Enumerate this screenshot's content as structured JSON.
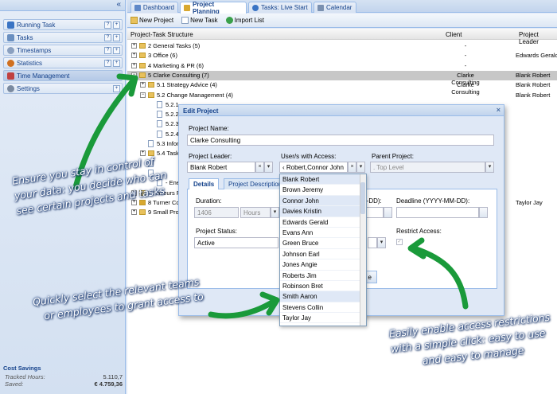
{
  "sidebar": {
    "collapse_glyph": "«",
    "items": [
      {
        "label": "Running Task",
        "icon": "play-icon",
        "color": "#3a74c4"
      },
      {
        "label": "Tasks",
        "icon": "tasks-icon",
        "color": "#6a8fc0"
      },
      {
        "label": "Timestamps",
        "icon": "clock-icon",
        "color": "#8aa0c0"
      },
      {
        "label": "Statistics",
        "icon": "chart-icon",
        "color": "#d07020"
      },
      {
        "label": "Time Management",
        "icon": "calendar-icon",
        "color": "#c04040"
      },
      {
        "label": "Settings",
        "icon": "gear-icon",
        "color": "#7a8aa0"
      }
    ],
    "btn_help": "?",
    "btn_add": "+",
    "costs": {
      "title": "Cost Savings",
      "tracked_label": "Tracked Hours:",
      "tracked_value": "5.110,7",
      "saved_label": "Saved:",
      "saved_value": "€ 4.759,36"
    }
  },
  "tabs": [
    {
      "label": "Dashboard",
      "color": "#5f88c8"
    },
    {
      "label": "Project Planning",
      "color": "#d8a830"
    },
    {
      "label": "Tasks: Live Start",
      "color": "#3a74c4"
    },
    {
      "label": "Calendar",
      "color": "#7a90b0"
    }
  ],
  "toolbar": {
    "new_project": "New Project",
    "new_task": "New Task",
    "import_list": "Import List"
  },
  "grid": {
    "col_structure": "Project-Task Structure",
    "col_client": "Client",
    "col_leader": "Project Leader",
    "rows": [
      {
        "text": "2 General Tasks (5)",
        "client": "-",
        "leader": ""
      },
      {
        "text": "3 Office (6)",
        "client": "-",
        "leader": "Edwards Gerald"
      },
      {
        "text": "4 Marketing & PR (6)",
        "client": "-",
        "leader": ""
      },
      {
        "text": "5 Clarke Consulting (7)",
        "client": "Clarke Consulting",
        "leader": "Blank Robert"
      },
      {
        "text": "5.1 Strategy Advice (4)",
        "client": "Clarke Consulting",
        "leader": "Blank Robert"
      },
      {
        "text": "5.2 Change Management (4)",
        "client": "",
        "leader": "Blank Robert"
      },
      {
        "text": "5.2.1",
        "client": "",
        "leader": ""
      },
      {
        "text": "5.2.2",
        "client": "",
        "leader": ""
      },
      {
        "text": "5.2.3",
        "client": "",
        "leader": ""
      },
      {
        "text": "5.2.4",
        "client": "",
        "leader": ""
      },
      {
        "text": "5.3 Infor",
        "client": "",
        "leader": ""
      },
      {
        "text": "5.4 Task",
        "client": "",
        "leader": ""
      },
      {
        "text": "",
        "client": "",
        "leader": ""
      },
      {
        "text": "",
        "client": "",
        "leader": ""
      },
      {
        "text": "- Ene",
        "client": "",
        "leader": ""
      },
      {
        "text": "7 Saveurs F",
        "client": "",
        "leader": ""
      },
      {
        "text": "8 Turner Co",
        "client": "",
        "leader": "Taylor Jay"
      },
      {
        "text": "9 Small Proj",
        "client": "",
        "leader": ""
      }
    ]
  },
  "dialog": {
    "title": "Edit Project",
    "close_glyph": "×",
    "name_label": "Project Name:",
    "name_value": "Clarke Consulting",
    "leader_label": "Project Leader:",
    "leader_value": "Blank Robert",
    "users_label": "User/s with Access:",
    "users_value": "‹ Robert,Connor John",
    "parent_label": "Parent Project:",
    "parent_value": ". Top Level",
    "tab_details": "Details",
    "tab_description": "Project Description",
    "duration_label": "Duration:",
    "duration_value": "1406",
    "duration_unit": "Hours",
    "start_label_tail": "M-DD):",
    "deadline_label": "Deadline (YYYY-MM-DD):",
    "status_label": "Project Status:",
    "status_value": "Active",
    "restrict_label": "Restrict Access:",
    "save_partial": "e",
    "trigger_clear": "×",
    "trigger_down": "▾"
  },
  "user_list": [
    "Blank Robert",
    "Brown Jeremy",
    "Connor John",
    "Davies Kristin",
    "Edwards Gerald",
    "Evans Ann",
    "Green Bruce",
    "Johnson Earl",
    "Jones Angie",
    "Roberts Jim",
    "Robinson Bret",
    "Smith Aaron",
    "Stevens Collin",
    "Taylor Jay"
  ],
  "notes": {
    "control": [
      "Ensure  you stay in control of",
      "your data: you decide who can",
      "see certain projects and tasks"
    ],
    "select": [
      "Quickly select the relevant teams",
      "or employees to grant access to"
    ],
    "restrict": [
      "Easily enable access restrictions",
      "with a simple click: easy to use",
      "and easy to manage"
    ]
  },
  "colors": {
    "arrow": "#1a9a3a",
    "accent": "#15428b",
    "selected_row": "#c7c7c7"
  }
}
